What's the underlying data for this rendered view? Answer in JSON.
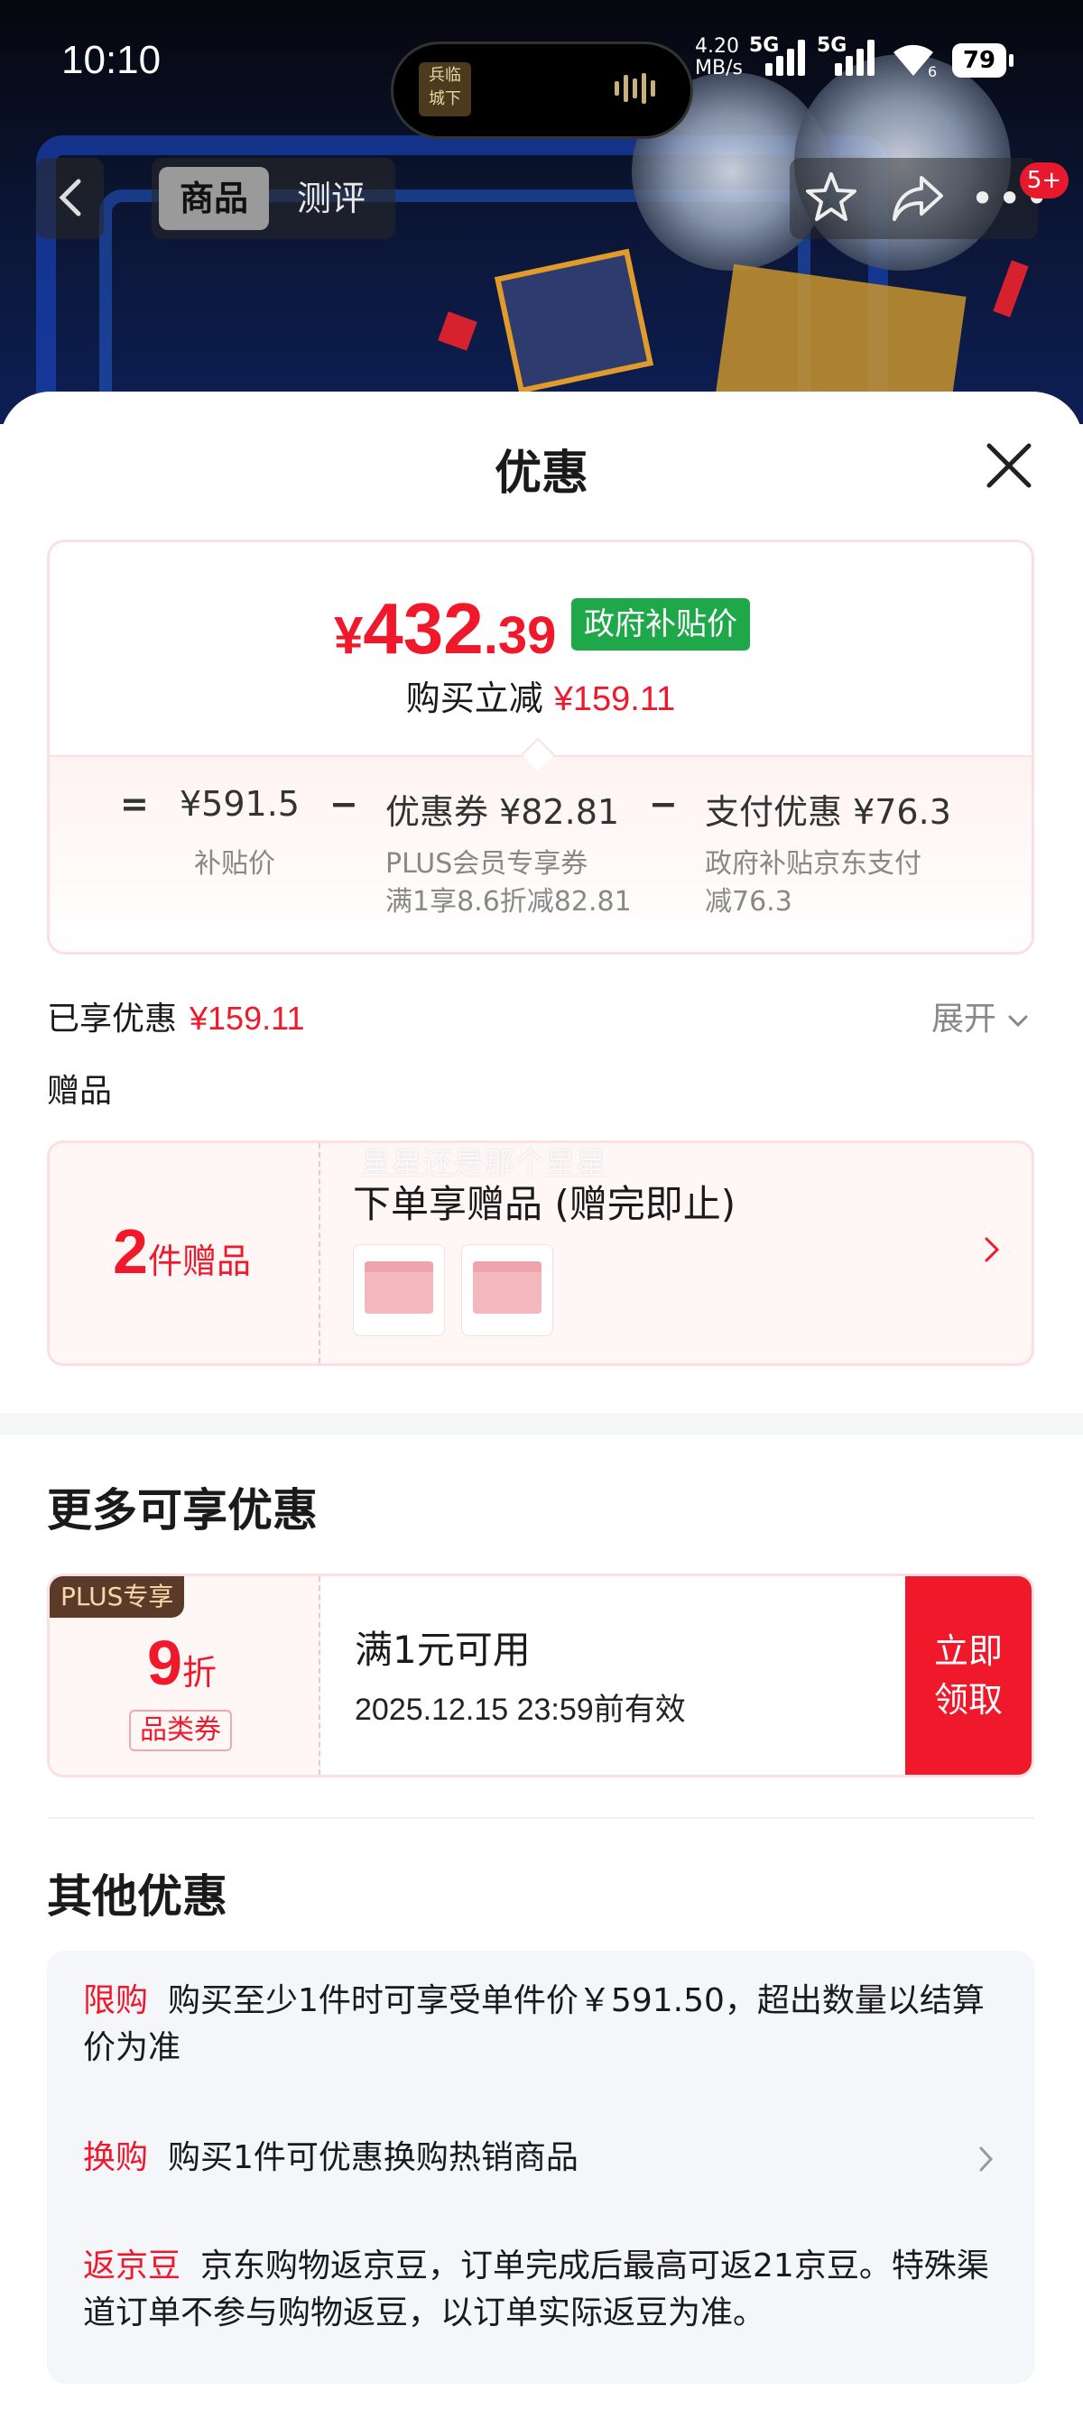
{
  "status_bar": {
    "time": "10:10",
    "island_thumb_text": "兵临城下",
    "net_speed_value": "4.20",
    "net_speed_unit": "MB/s",
    "sim1": "5G",
    "sim2": "5G",
    "wifi_label": "6",
    "battery": "79"
  },
  "nav": {
    "tabs": [
      "商品",
      "测评"
    ],
    "active_tab": "商品",
    "badge": "5+"
  },
  "sheet": {
    "title": "优惠"
  },
  "price_card": {
    "symbol": "¥",
    "price_int": "432",
    "price_dec": ".39",
    "gov_tag": "政府补贴价",
    "saving_label": "购买立减",
    "saving_amount": "¥159.11",
    "formula": {
      "eq": "=",
      "base": "¥591.5",
      "minus1": "−",
      "coupon": "优惠券 ¥82.81",
      "minus2": "−",
      "pay": "支付优惠 ¥76.3"
    },
    "notes": {
      "base": "补贴价",
      "coupon_line1": "PLUS会员专享券",
      "coupon_line2": "满1享8.6折减82.81",
      "pay_line1": "政府补贴京东支付",
      "pay_line2": "减76.3"
    }
  },
  "enjoyed": {
    "label": "已享优惠",
    "amount": "¥159.11",
    "expand": "展开"
  },
  "gift": {
    "section_title": "赠品",
    "count": "2",
    "unit": "件赠品",
    "headline": "下单享赠品 (赠完即止)",
    "watermark": "星星还是那个星星"
  },
  "more": {
    "title": "更多可享优惠",
    "coupon": {
      "plus_tag": "PLUS专享",
      "discount": "9",
      "discount_unit": "折",
      "category": "品类券",
      "condition": "满1元可用",
      "validity": "2025.12.15 23:59前有效",
      "claim_line1": "立即",
      "claim_line2": "领取"
    }
  },
  "other": {
    "title": "其他优惠",
    "rows": [
      {
        "key": "限购",
        "text": "购买至少1件时可享受单件价￥591.50，超出数量以结算价为准"
      },
      {
        "key": "换购",
        "text": "购买1件可优惠换购热销商品"
      },
      {
        "key": "返京豆",
        "text": "京东购物返京豆，订单完成后最高可返21京豆。特殊渠道订单不参与购物返豆，以订单实际返豆为准。"
      }
    ]
  },
  "colors": {
    "price_red": "#f0192c",
    "gov_green": "#1fa84a",
    "plus_brown": "#5c3a2a"
  }
}
